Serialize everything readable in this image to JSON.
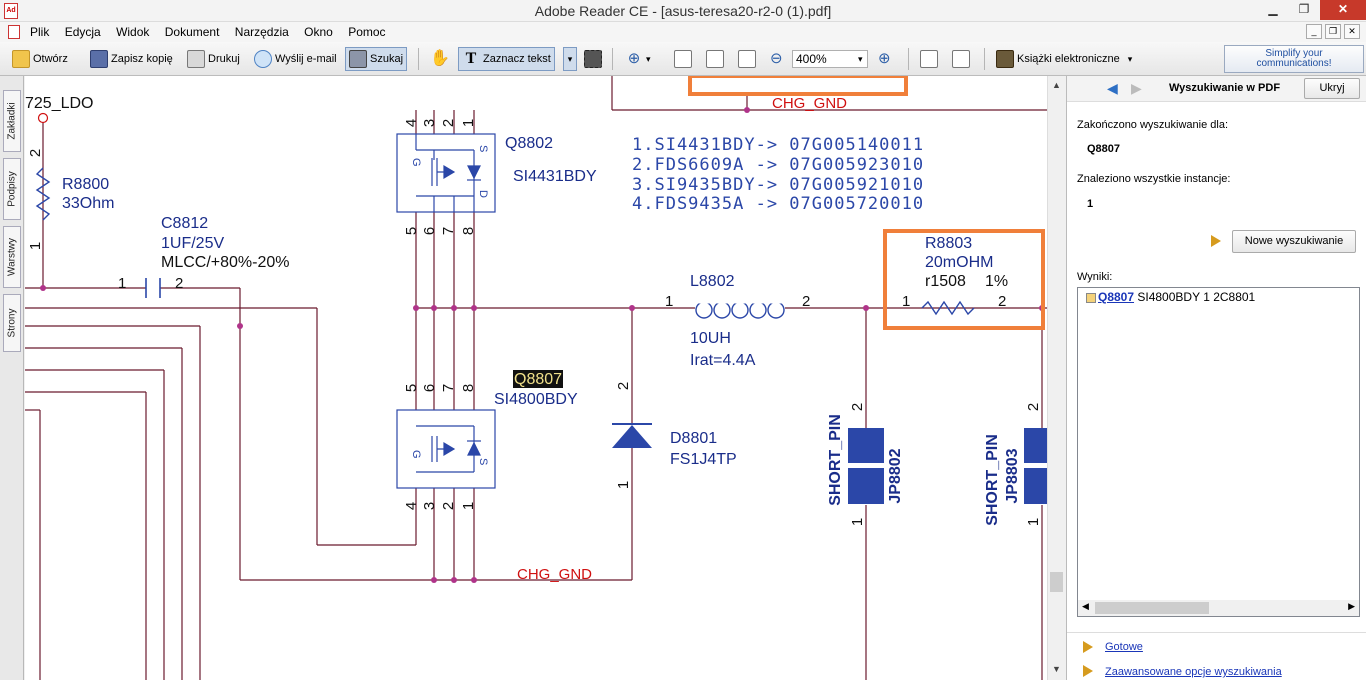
{
  "window": {
    "title": "Adobe Reader CE - [asus-teresa20-r2-0 (1).pdf]",
    "app_icon_text": "Ad"
  },
  "menu": {
    "items": [
      "Plik",
      "Edycja",
      "Widok",
      "Dokument",
      "Narzędzia",
      "Okno",
      "Pomoc"
    ]
  },
  "toolbar": {
    "open": "Otwórz",
    "save_copy": "Zapisz kopię",
    "print": "Drukuj",
    "email": "Wyślij e-mail",
    "search": "Szukaj",
    "select_text": "Zaznacz tekst",
    "zoom_value": "400%",
    "ebooks": "Książki elektroniczne",
    "ad_line1": "Simplify your",
    "ad_line2": "communications!"
  },
  "left_tabs": [
    "Zakładki",
    "Podpisy",
    "Warstwy",
    "Strony"
  ],
  "schematic": {
    "ldo_label": "725_LDO",
    "r8800_name": "R8800",
    "r8800_value": "33Ohm",
    "r8800_pin2": "2",
    "r8800_pin1": "1",
    "c8812_name": "C8812",
    "c8812_value": "1UF/25V",
    "c8812_spec": "MLCC/+80%-20%",
    "c_pin1": "1",
    "c_pin2": "2",
    "q8802_name": "Q8802",
    "q8802_part": "SI4431BDY",
    "q8807_name": "Q8807",
    "q8807_part": "SI4800BDY",
    "alt_parts": [
      "1.SI4431BDY-> 07G005140011",
      "2.FDS6609A -> 07G005923010",
      "3.SI9435BDY-> 07G005921010",
      "4.FDS9435A -> 07G005720010"
    ],
    "pins_top": [
      "4",
      "3",
      "2",
      "1"
    ],
    "pins_mid": [
      "5",
      "6",
      "7",
      "8"
    ],
    "pins_q8807_top": [
      "5",
      "6",
      "7",
      "8"
    ],
    "pins_q8807_bot": [
      "4",
      "3",
      "2",
      "1"
    ],
    "mos_g": "G",
    "mos_s": "S",
    "mos_d": "D",
    "l8802_name": "L8802",
    "l8802_value": "10UH",
    "l8802_irat": "Irat=4.4A",
    "l_pin1": "1",
    "l_pin2": "2",
    "r8803_name": "R8803",
    "r8803_value": "20mOHM",
    "r8803_footprint": "r1508",
    "r8803_tol": "1%",
    "r8803_pin1": "1",
    "r8803_pin2": "2",
    "d8801_name": "D8801",
    "d8801_part": "FS1J4TP",
    "d_pin2": "2",
    "d_pin1": "1",
    "chg_gnd_top": "CHG_GND",
    "chg_gnd_bottom": "CHG_GND",
    "jp8802_label": "SHORT_PIN",
    "jp8802_name": "JP8802",
    "jp8803_label": "SHORT_PIN",
    "jp8803_name": "JP8803",
    "jp_pin2": "2",
    "jp_pin1": "1"
  },
  "search_panel": {
    "title": "Wyszukiwanie w PDF",
    "hide_button": "Ukryj",
    "finished_label": "Zakończono wyszukiwanie dla:",
    "query": "Q8807",
    "found_label": "Znaleziono wszystkie instancje:",
    "count": "1",
    "new_search_button": "Nowe wyszukiwanie",
    "results_label": "Wyniki:",
    "result_match": "Q8807",
    "result_context": " SI4800BDY 1 2C8801",
    "done_link": "Gotowe",
    "advanced_link": "Zaawansowane opcje wyszukiwania"
  },
  "colors": {
    "wire": "#6b1a2e",
    "dot": "#b0348a",
    "text_blue": "#1a2d8a",
    "net_red": "#d01010",
    "highlight_orange": "#f07f3a",
    "component_blue": "#2b47a8"
  }
}
